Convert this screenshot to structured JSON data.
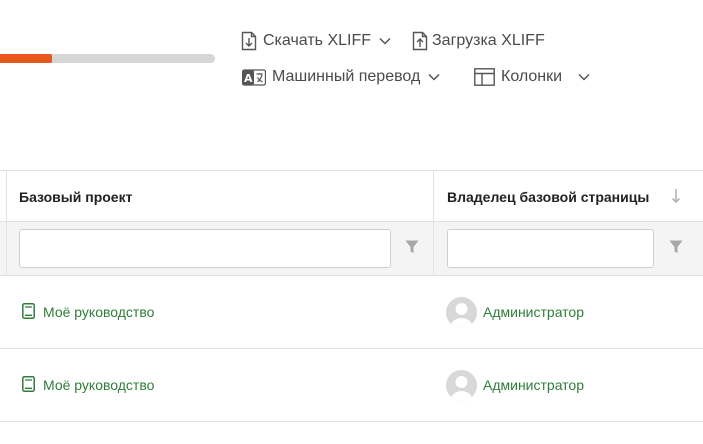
{
  "progress": {
    "fraction": 0.24,
    "color": "#e8571d"
  },
  "toolbar": {
    "download": {
      "label": "Скачать XLIFF",
      "icon": "file-download-icon"
    },
    "upload": {
      "label": "Загрузка XLIFF",
      "icon": "file-upload-icon"
    },
    "machine_translation": {
      "label": "Машинный перевод",
      "icon": "translate-icon"
    },
    "columns": {
      "label": "Колонки",
      "icon": "columns-icon"
    }
  },
  "table": {
    "columns": [
      {
        "header": "Базовый проект"
      },
      {
        "header": "Владелец базовой страницы"
      }
    ],
    "rows": [
      {
        "project": "Моё руководство",
        "owner": "Администратор"
      },
      {
        "project": "Моё руководство",
        "owner": "Администратор"
      }
    ]
  },
  "colors": {
    "link": "#2e7d3a",
    "accent": "#e8571d"
  }
}
